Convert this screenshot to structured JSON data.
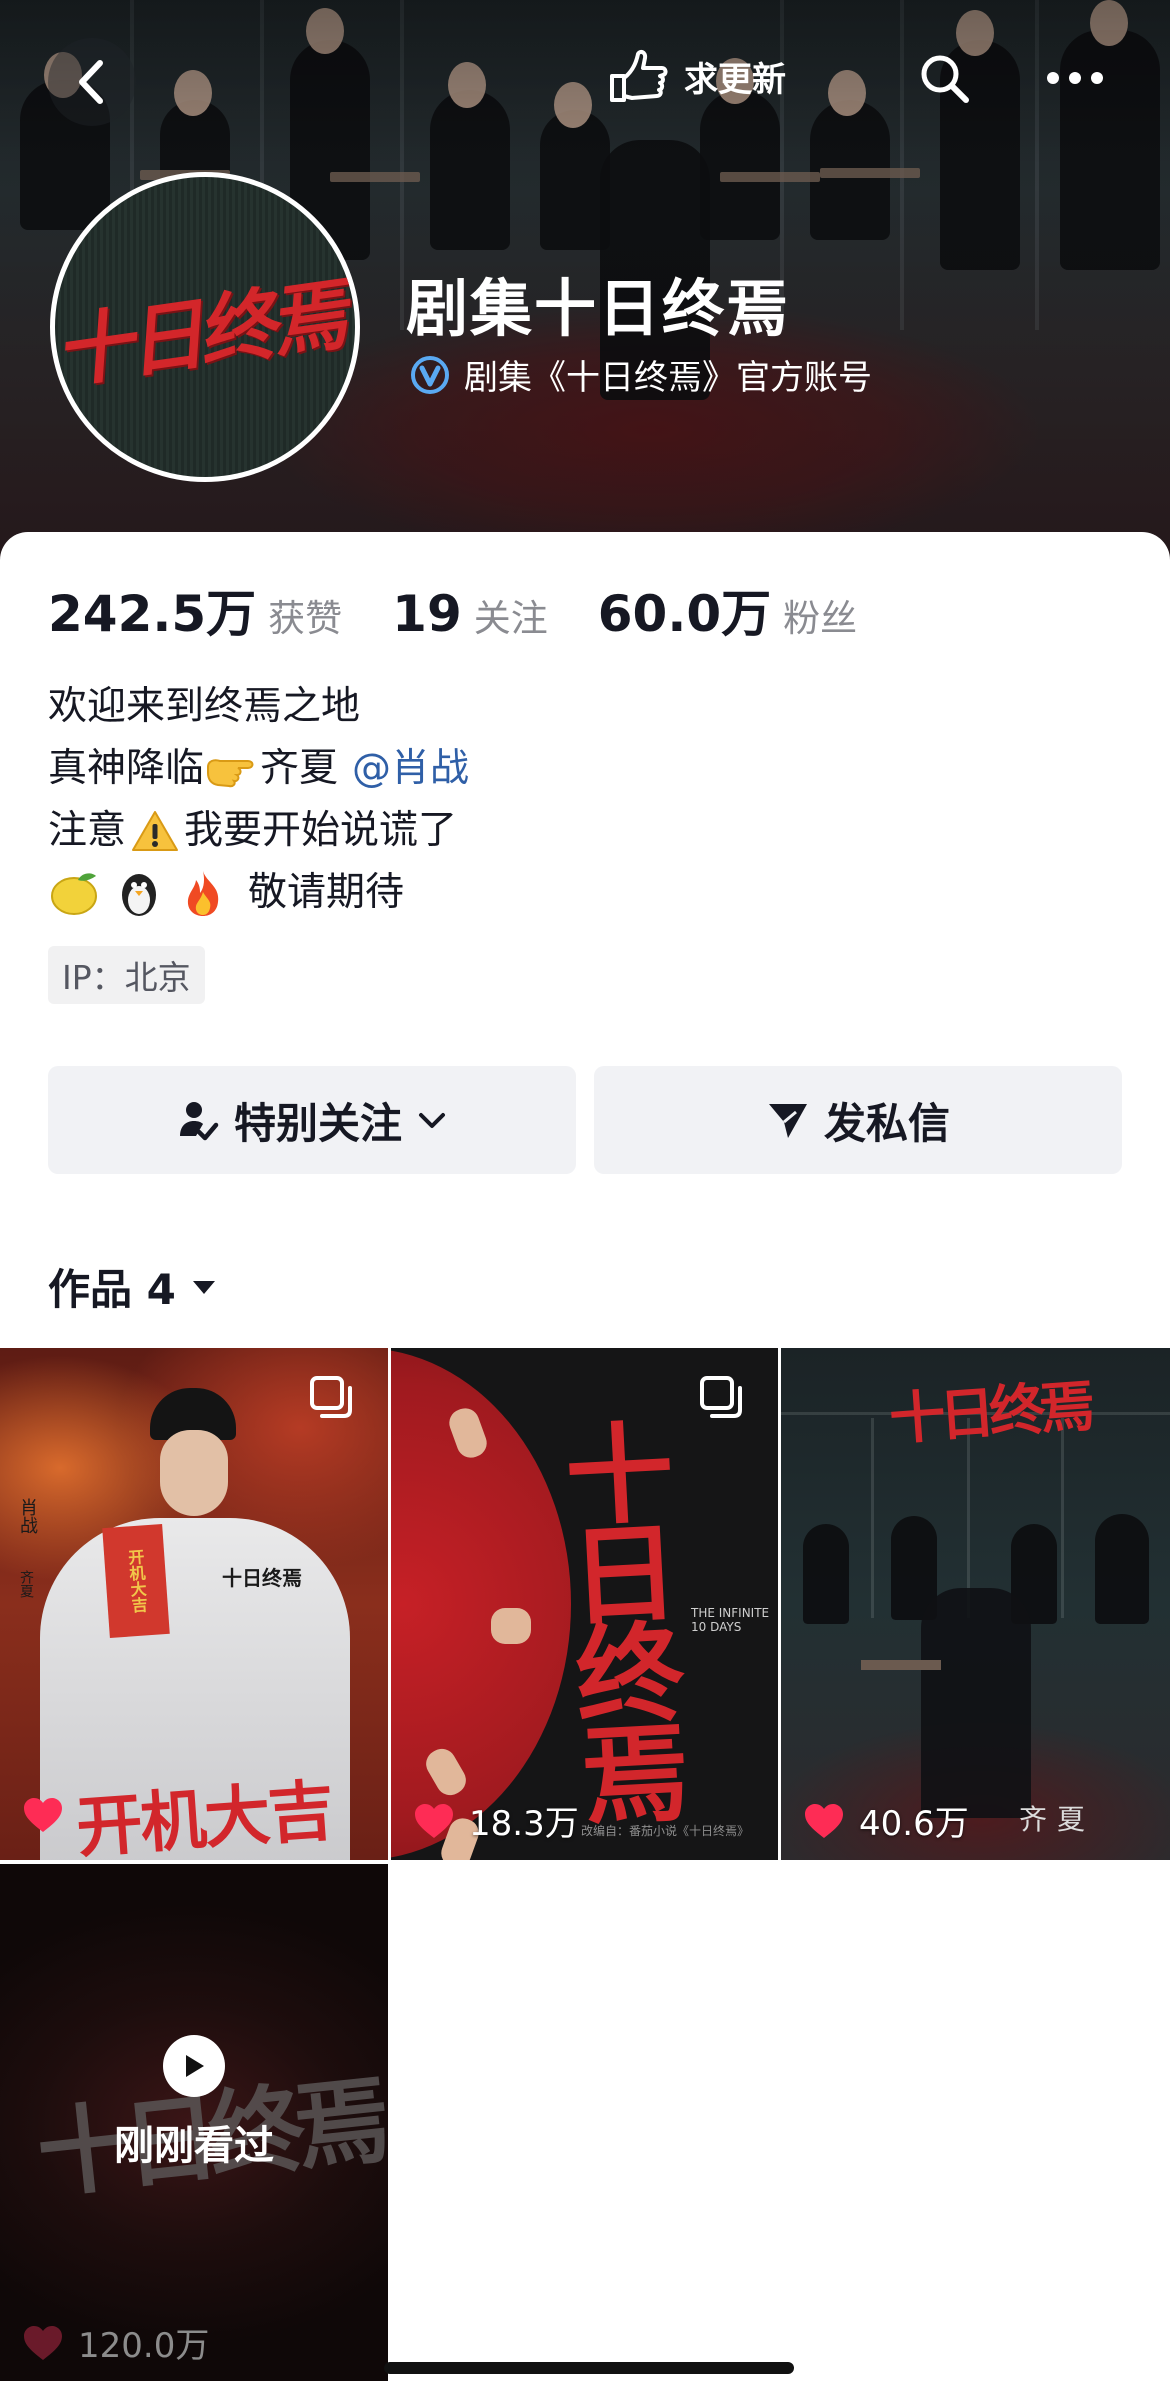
{
  "topbar": {
    "update_label": "求更新"
  },
  "profile": {
    "name": "剧集十日终焉",
    "verified_text": "剧集《十日终焉》官方账号",
    "avatar_text": "十日终焉",
    "stats": [
      {
        "value": "242.5万",
        "label": "获赞"
      },
      {
        "value": "19",
        "label": "关注"
      },
      {
        "value": "60.0万",
        "label": "粉丝"
      }
    ],
    "bio": {
      "line1": "欢迎来到终焉之地",
      "line2_a": "真神降临",
      "line2_b": "齐夏",
      "line2_mention": "@肖战",
      "line3_a": "注意",
      "line3_b": "我要开始说谎了",
      "line4": "敬请期待"
    },
    "ip": "IP：北京"
  },
  "actions": {
    "follow_label": "特别关注",
    "dm_label": "发私信"
  },
  "works": {
    "tab_label": "作品 4",
    "items": [
      {
        "likes": "",
        "caption": "开机大吉",
        "side_name": "肖战",
        "side_role": "齐夏",
        "envelope": "开机大吉",
        "shirt": "十日终焉"
      },
      {
        "likes": "18.3万",
        "title": "十日终焉",
        "subtitle": "THE INFINITE 10 DAYS",
        "footer": "改编自：番茄小说《十日终焉》"
      },
      {
        "likes": "40.6万",
        "title": "十日终焉",
        "role": "齐夏"
      },
      {
        "likes": "120.0万",
        "overlay": "刚刚看过",
        "title": "十日终焉"
      }
    ]
  },
  "colors": {
    "accent_red": "#fe2c55",
    "mention_blue": "#2f5fa7",
    "verify_blue": "#5aa9f2"
  }
}
